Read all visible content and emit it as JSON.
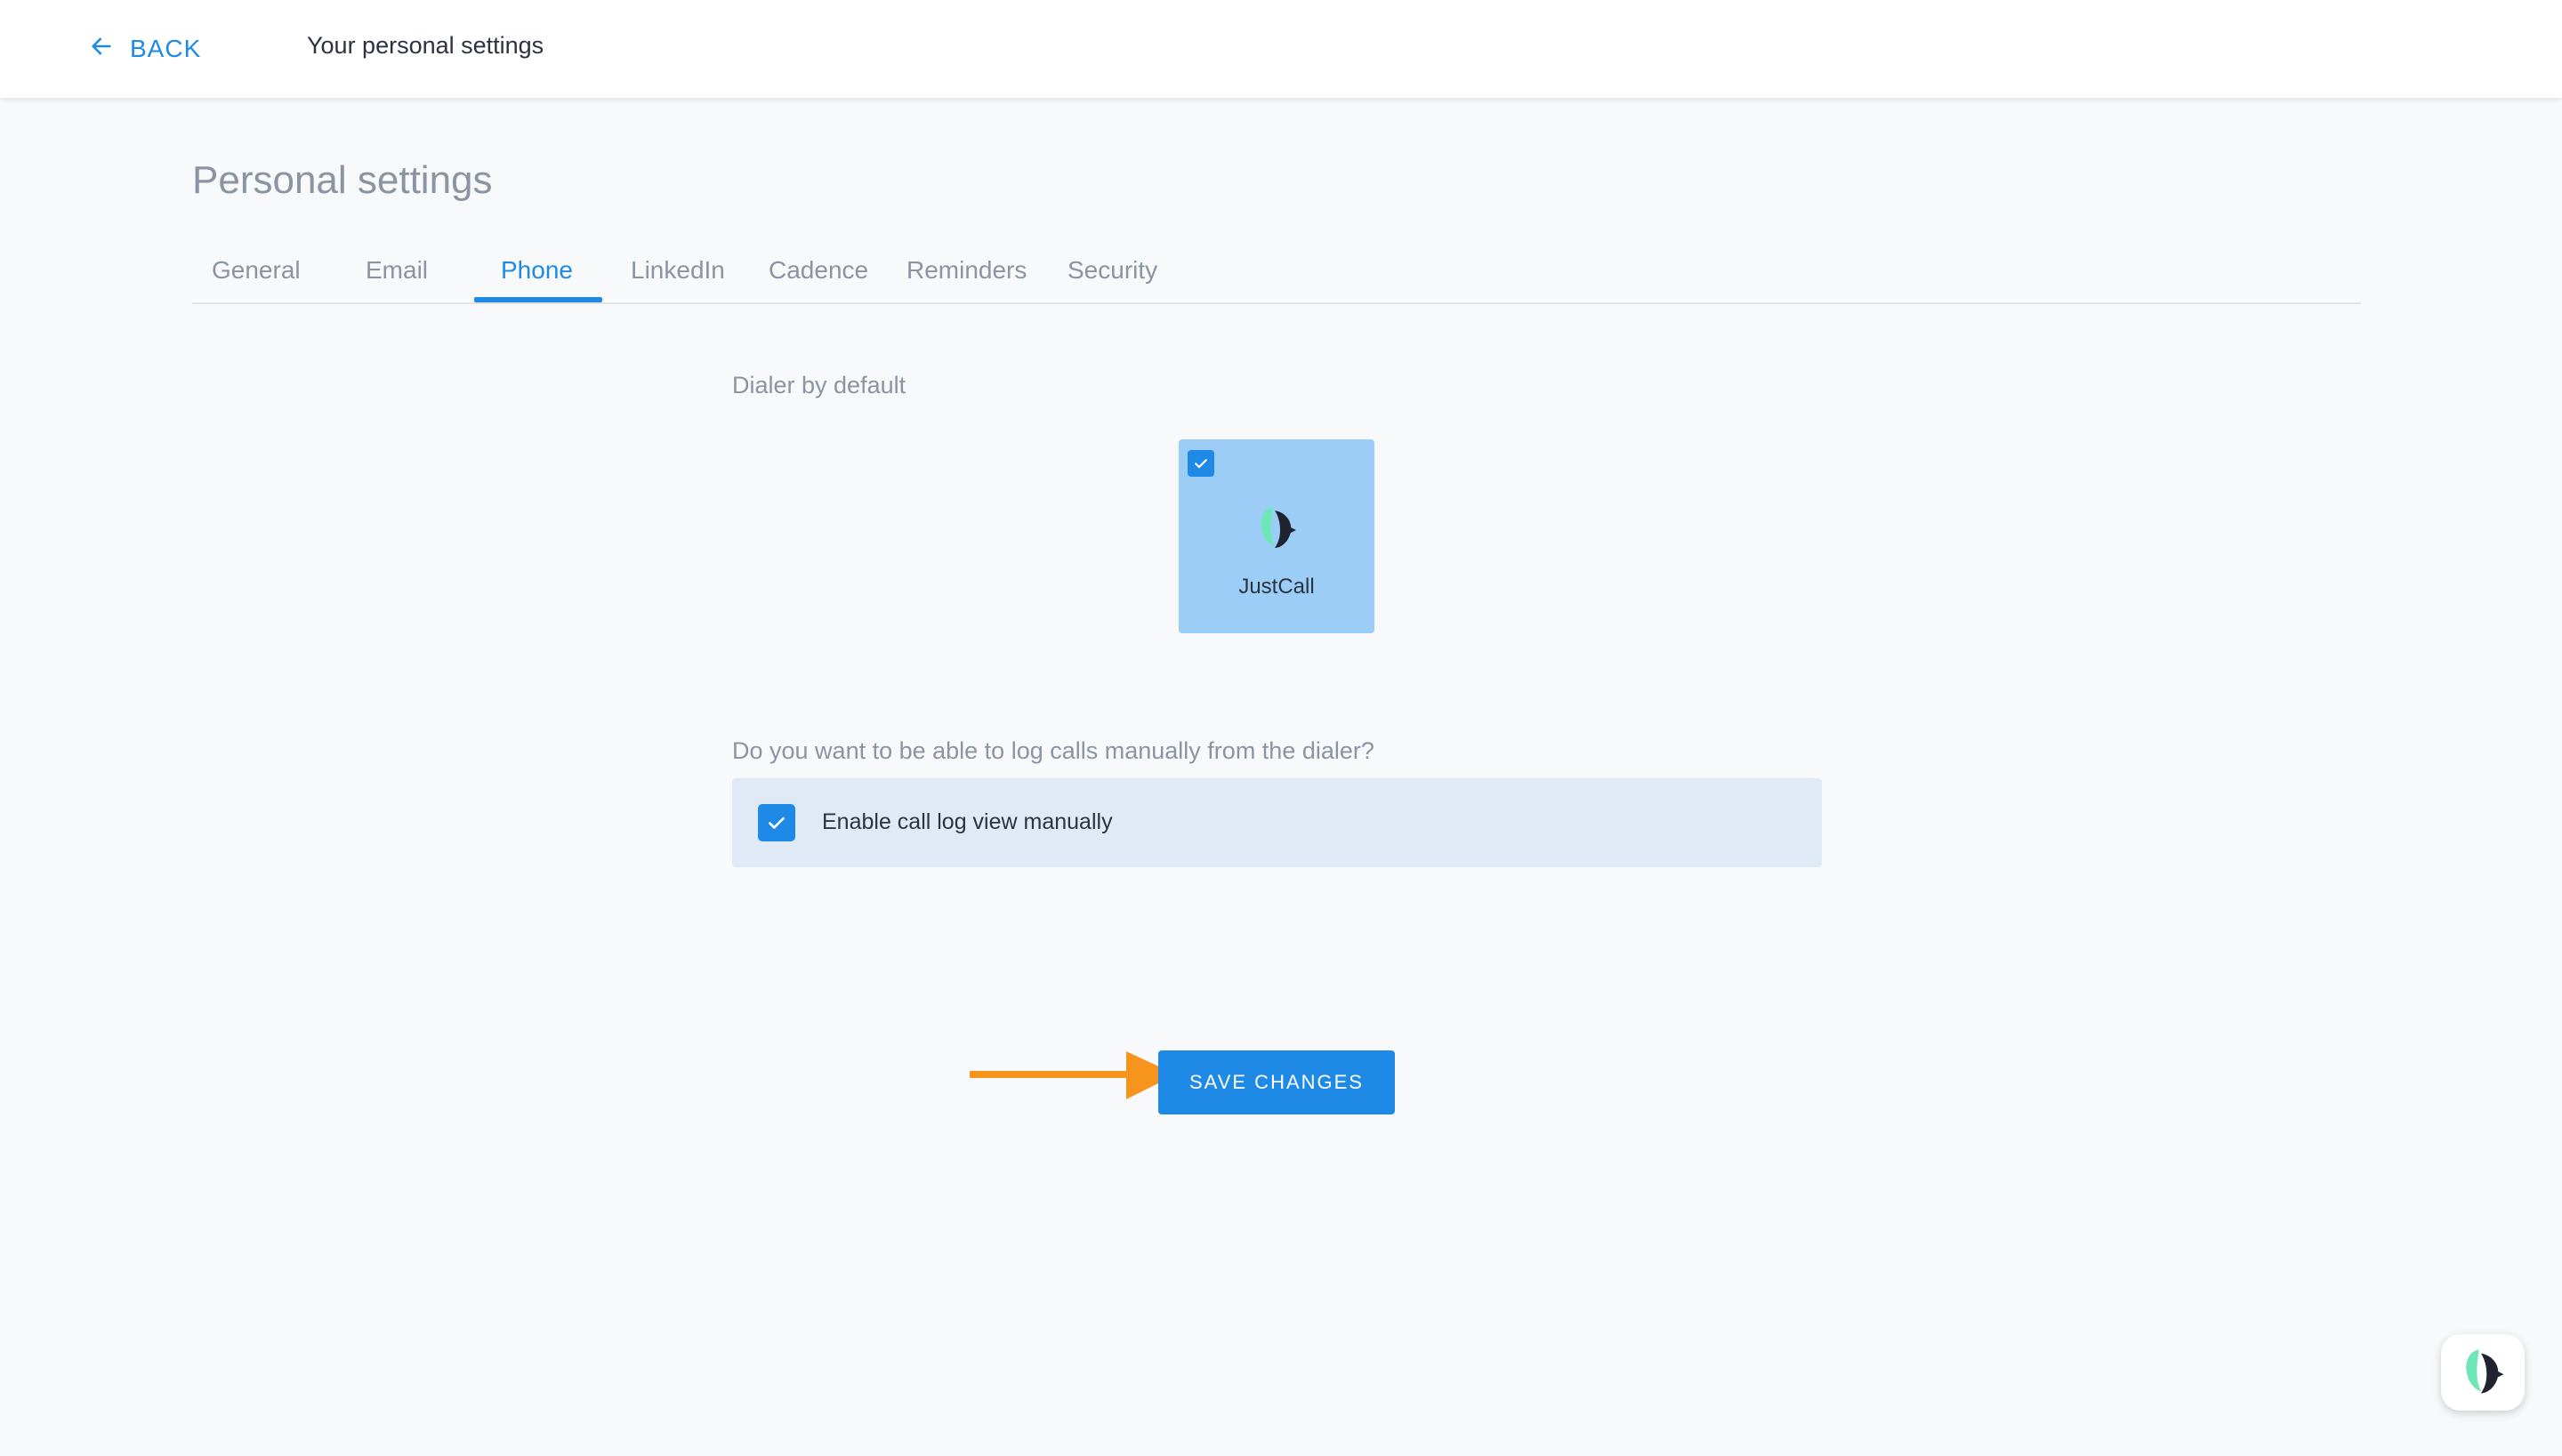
{
  "header": {
    "back_label": "BACK",
    "title": "Your personal settings"
  },
  "page": {
    "title": "Personal settings"
  },
  "tabs": [
    {
      "label": "General",
      "active": false
    },
    {
      "label": "Email",
      "active": false
    },
    {
      "label": "Phone",
      "active": true
    },
    {
      "label": "LinkedIn",
      "active": false
    },
    {
      "label": "Cadence",
      "active": false
    },
    {
      "label": "Reminders",
      "active": false
    },
    {
      "label": "Security",
      "active": false
    }
  ],
  "dialer": {
    "section_label": "Dialer by default",
    "options": [
      {
        "name": "JustCall",
        "selected": true,
        "icon": "justcall-logo-icon"
      }
    ]
  },
  "call_log": {
    "question": "Do you want to be able to log calls manually from the dialer?",
    "checkbox_label": "Enable call log view manually",
    "checked": true
  },
  "actions": {
    "save_label": "SAVE CHANGES"
  },
  "colors": {
    "accent": "#1f8ae6",
    "card_selected": "#9ccdf7",
    "row_background": "#dfeaf6",
    "annotation_arrow": "#f7941d",
    "page_background": "#f8f9fb"
  },
  "icons": {
    "back": "arrow-left-icon",
    "checkbox": "checkmark-icon",
    "annotation": "orange-arrow-annotation",
    "floating_widget": "justcall-logo-icon"
  }
}
